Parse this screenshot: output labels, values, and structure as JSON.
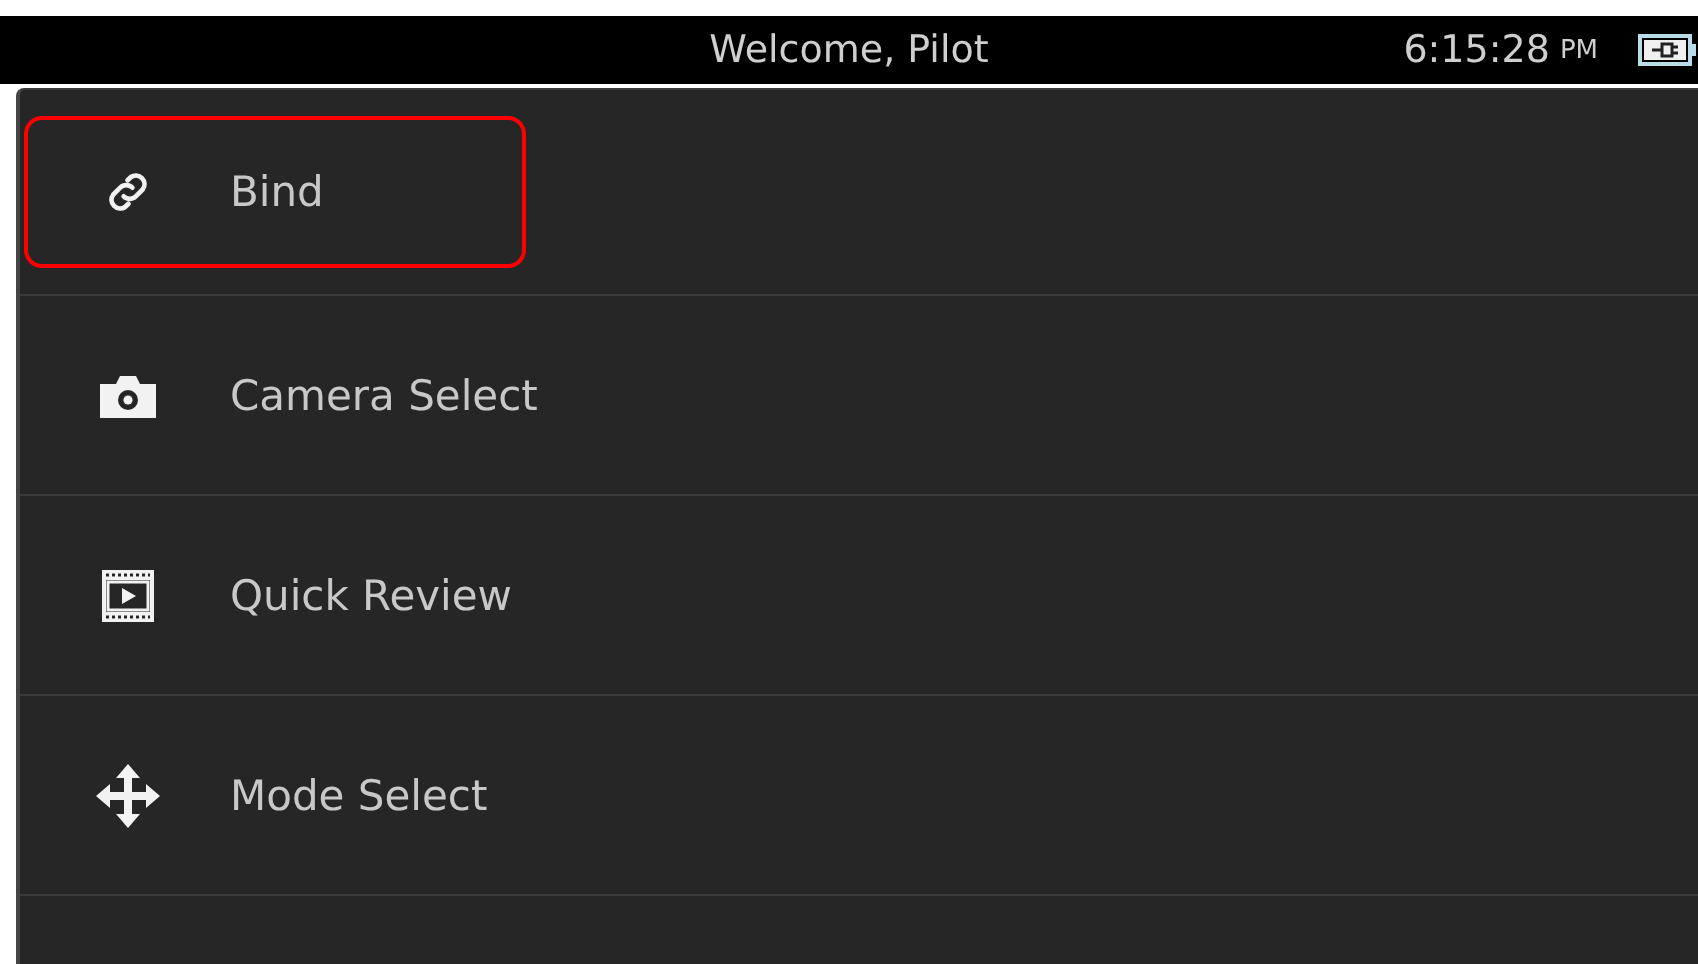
{
  "status_bar": {
    "title": "Welcome, Pilot",
    "time": "6:15:28",
    "meridiem": "PM",
    "charging": true
  },
  "menu": {
    "items": [
      {
        "kind": "link",
        "label": "Bind",
        "selected": true
      },
      {
        "kind": "camera",
        "label": "Camera Select",
        "selected": false
      },
      {
        "kind": "film",
        "label": "Quick Review",
        "selected": false
      },
      {
        "kind": "move",
        "label": "Mode Select",
        "selected": false
      }
    ]
  }
}
